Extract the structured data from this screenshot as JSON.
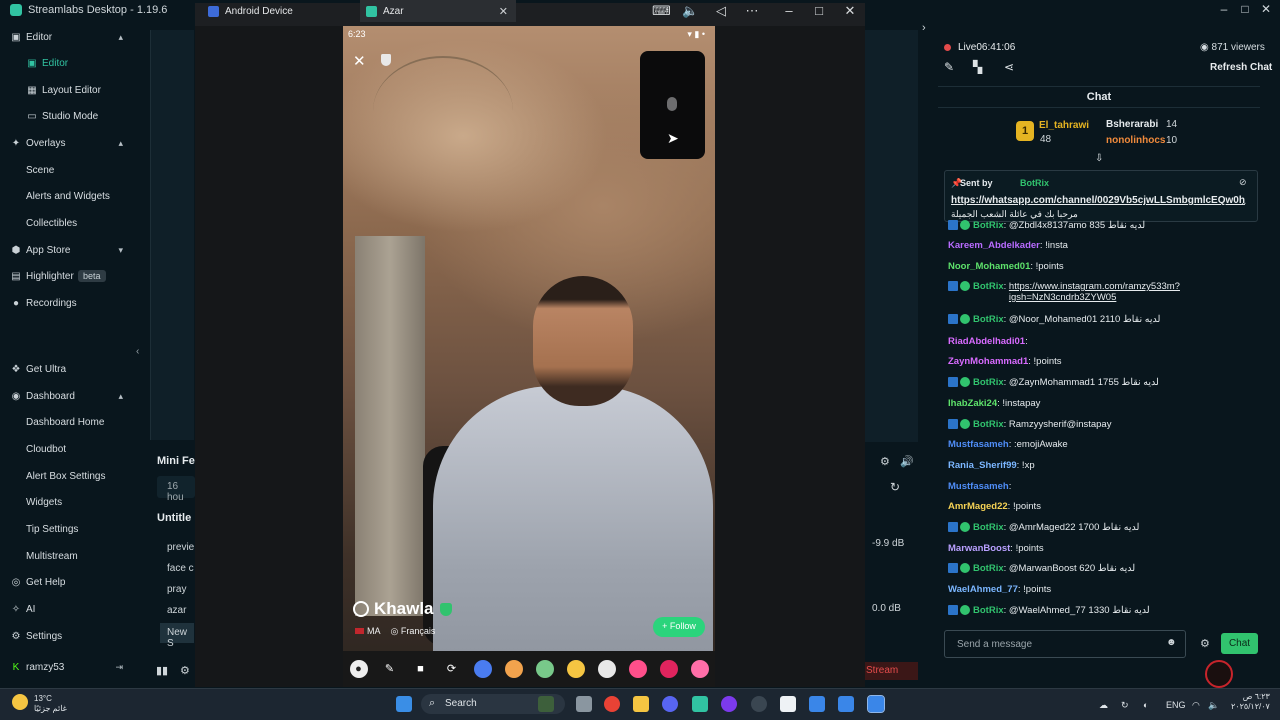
{
  "app": {
    "title": "Streamlabs Desktop - 1.19.6"
  },
  "sidebar": {
    "items": [
      {
        "label": "Editor",
        "chev": "▴"
      },
      {
        "label": "Editor",
        "active": true
      },
      {
        "label": "Layout Editor"
      },
      {
        "label": "Studio Mode"
      },
      {
        "label": "Overlays",
        "chev": "▴"
      },
      {
        "label": "Scene"
      },
      {
        "label": "Alerts and Widgets"
      },
      {
        "label": "Collectibles"
      },
      {
        "label": "App Store",
        "chev": "▾"
      },
      {
        "label": "Highlighter",
        "badge": "beta"
      },
      {
        "label": "Recordings"
      },
      {
        "label": "Get Ultra"
      },
      {
        "label": "Dashboard",
        "chev": "▴"
      },
      {
        "label": "Dashboard Home"
      },
      {
        "label": "Cloudbot"
      },
      {
        "label": "Alert Box Settings"
      },
      {
        "label": "Widgets"
      },
      {
        "label": "Tip Settings"
      },
      {
        "label": "Multistream"
      },
      {
        "label": "Get Help"
      },
      {
        "label": "AI"
      },
      {
        "label": "Settings"
      },
      {
        "label": "ramzy53"
      }
    ]
  },
  "mini_feed": {
    "title": "Mini Fe",
    "filter": "16 hou"
  },
  "scenes": {
    "title": "Untitle",
    "items": [
      "previe",
      "face c",
      "pray",
      "azar",
      "New S"
    ]
  },
  "mixer": {
    "db1": "-9.9 dB",
    "db2": "0.0 dB",
    "stream_label": "Stream"
  },
  "android_window": {
    "tabs": [
      {
        "label": "Android Device"
      },
      {
        "label": "Azar"
      }
    ]
  },
  "phone": {
    "time": "6:23",
    "name": "Khawla",
    "country": "MA",
    "language": "Français",
    "follow": "+ Follow"
  },
  "chat_panel": {
    "live_label": "Live",
    "live_time": "06:41:06",
    "viewers": "871 viewers",
    "refresh": "Refresh Chat",
    "header": "Chat",
    "leaderboard": {
      "rank": "1",
      "first_name": "El_tahrawi",
      "first_value": "48",
      "entries": [
        {
          "name": "Bsherarabi",
          "value": "14"
        },
        {
          "name": "nonolinhocs",
          "value": "10"
        }
      ]
    },
    "pinned": {
      "sent_by": "Sent by",
      "bot": "BotRix",
      "link": "https://whatsapp.com/channel/0029Vb5cjwLLSmbgmlcEQw0h",
      "message": "مرحبا بك في عائلة الشعب الجميلة"
    },
    "messages": [
      {
        "user": "BotRix",
        "text": ": @Zbdl4x8137amo 835 لديه نقاط",
        "color": "#31c36e",
        "bot": true
      },
      {
        "user": "Kareem_Abdelkader",
        "text": ": !insta",
        "color": "#b86bff",
        "bot": false
      },
      {
        "user": "Noor_Mohamed01",
        "text": ": !points",
        "color": "#5ee26b",
        "bot": false
      },
      {
        "user": "BotRix",
        "text": ": ",
        "link": "https://www.instagram.com/ramzy533m?igsh=NzN3cndrb3ZYW05",
        "color": "#31c36e",
        "bot": true
      },
      {
        "user": "BotRix",
        "text": ": @Noor_Mohamed01 2110 لديه نقاط",
        "color": "#31c36e",
        "bot": true
      },
      {
        "user": "RiadAbdelhadi01",
        "text": ": ",
        "color": "#d86bff",
        "bot": false
      },
      {
        "user": "ZaynMohammad1",
        "text": ": !points",
        "color": "#d86bff",
        "bot": false
      },
      {
        "user": "BotRix",
        "text": ": @ZaynMohammad1 1755 لديه نقاط",
        "color": "#31c36e",
        "bot": true
      },
      {
        "user": "IhabZaki24",
        "text": ": !instapay",
        "color": "#5ee26b",
        "bot": false
      },
      {
        "user": "BotRix",
        "text": ": Ramzyysherif@instapay",
        "color": "#31c36e",
        "bot": true
      },
      {
        "user": "Mustfasameh",
        "text": ": :emojiAwake",
        "color": "#4f8df7",
        "bot": false
      },
      {
        "user": "Rania_Sherif99",
        "text": ": !xp",
        "color": "#7bb6ff",
        "bot": false
      },
      {
        "user": "Mustfasameh",
        "text": ": ",
        "color": "#4f8df7",
        "bot": false
      },
      {
        "user": "AmrMaged22",
        "text": ": !points",
        "color": "#f5d255",
        "bot": false
      },
      {
        "user": "BotRix",
        "text": ": @AmrMaged22 1700 لديه نقاط",
        "color": "#31c36e",
        "bot": true
      },
      {
        "user": "MarwanBoost",
        "text": ": !points",
        "color": "#b9a0ff",
        "bot": false
      },
      {
        "user": "BotRix",
        "text": ": @MarwanBoost 620 لديه نقاط",
        "color": "#31c36e",
        "bot": true
      },
      {
        "user": "WaelAhmed_77",
        "text": ": !points",
        "color": "#7bb6ff",
        "bot": false
      },
      {
        "user": "BotRix",
        "text": ": @WaelAhmed_77 1330 لديه نقاط",
        "color": "#31c36e",
        "bot": true
      }
    ],
    "send_placeholder": "Send a message",
    "chat_button": "Chat"
  },
  "taskbar": {
    "weather_temp": "13°C",
    "weather_text": "غائم جزئيًا",
    "search": "Search",
    "lang": "ENG",
    "time": "٦:٢٣ ص",
    "date": "٢٠٢٥/١٢/٠٧"
  }
}
